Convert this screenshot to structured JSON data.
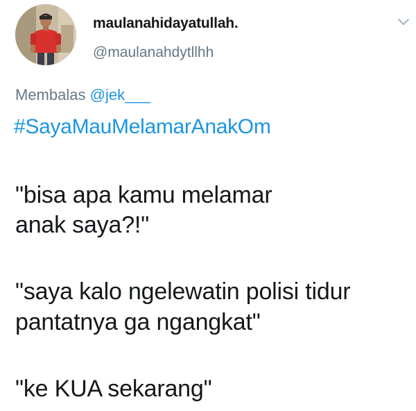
{
  "tweet": {
    "author": {
      "display_name": "maulanahidayatullah.",
      "handle": "@maulanahdytllhh",
      "avatar_icon": "user-photo-avatar"
    },
    "reply": {
      "prefix": "Membalas",
      "mention": "@jek___"
    },
    "hashtag": "#SayaMauMelamarAnakOm",
    "lines": [
      "\"bisa apa kamu melamar",
      "anak saya?!\"",
      "\"saya kalo ngelewatin polisi tidur",
      "pantatnya ga ngangkat\"",
      "\"ke KUA sekarang\""
    ],
    "menu_icon": "chevron-down-icon"
  },
  "colors": {
    "text": "#14171a",
    "secondary": "#657786",
    "link": "#1b95e0",
    "background": "#ffffff"
  }
}
